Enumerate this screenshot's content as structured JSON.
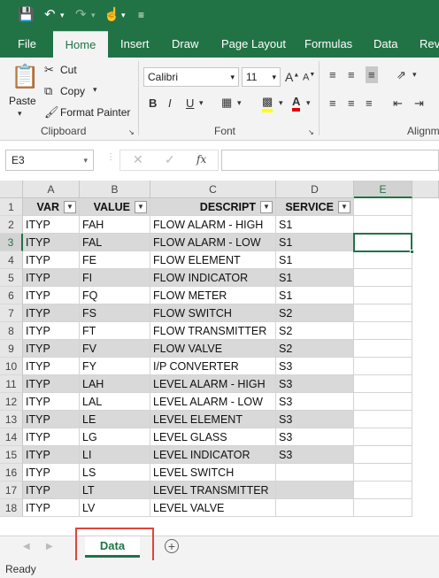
{
  "qat": {
    "save_icon": "save-icon",
    "undo_icon": "undo-icon",
    "redo_icon": "redo-icon",
    "touch_icon": "touch-mode-icon",
    "customize_icon": "customize-icon"
  },
  "tabs": [
    "File",
    "Home",
    "Insert",
    "Draw",
    "Page Layout",
    "Formulas",
    "Data",
    "Revi"
  ],
  "clipboard": {
    "paste": "Paste",
    "cut": "Cut",
    "copy": "Copy",
    "format_painter": "Format Painter",
    "label": "Clipboard"
  },
  "font": {
    "name": "Calibri",
    "size": "11",
    "label": "Font"
  },
  "alignment": {
    "label": "Alignm"
  },
  "formula_bar": {
    "name_box": "E3",
    "fx": "fx",
    "value": ""
  },
  "columns": [
    "A",
    "B",
    "C",
    "D",
    "E"
  ],
  "headers": [
    "VAR",
    "VALUE",
    "DESCRIPT",
    "SERVICE"
  ],
  "rows": [
    [
      "ITYP",
      "FAH",
      "FLOW ALARM - HIGH",
      "S1"
    ],
    [
      "ITYP",
      "FAL",
      "FLOW ALARM - LOW",
      "S1"
    ],
    [
      "ITYP",
      "FE",
      "FLOW ELEMENT",
      "S1"
    ],
    [
      "ITYP",
      "FI",
      "FLOW INDICATOR",
      "S1"
    ],
    [
      "ITYP",
      "FQ",
      "FLOW METER",
      "S1"
    ],
    [
      "ITYP",
      "FS",
      "FLOW SWITCH",
      "S2"
    ],
    [
      "ITYP",
      "FT",
      "FLOW TRANSMITTER",
      "S2"
    ],
    [
      "ITYP",
      "FV",
      "FLOW VALVE",
      "S2"
    ],
    [
      "ITYP",
      "FY",
      "I/P CONVERTER",
      "S3"
    ],
    [
      "ITYP",
      "LAH",
      "LEVEL ALARM - HIGH",
      "S3"
    ],
    [
      "ITYP",
      "LAL",
      "LEVEL ALARM - LOW",
      "S3"
    ],
    [
      "ITYP",
      "LE",
      "LEVEL ELEMENT",
      "S3"
    ],
    [
      "ITYP",
      "LG",
      "LEVEL GLASS",
      "S3"
    ],
    [
      "ITYP",
      "LI",
      "LEVEL INDICATOR",
      "S3"
    ],
    [
      "ITYP",
      "LS",
      "LEVEL SWITCH",
      ""
    ],
    [
      "ITYP",
      "LT",
      "LEVEL TRANSMITTER",
      ""
    ],
    [
      "ITYP",
      "LV",
      "LEVEL VALVE",
      ""
    ]
  ],
  "row_numbers": [
    "1",
    "2",
    "3",
    "4",
    "5",
    "6",
    "7",
    "8",
    "9",
    "10",
    "11",
    "12",
    "13",
    "14",
    "15",
    "16",
    "17",
    "18"
  ],
  "sheet": {
    "name": "Data"
  },
  "status": "Ready",
  "colors": {
    "accent": "#217346",
    "highlight_box": "#e0453a"
  }
}
